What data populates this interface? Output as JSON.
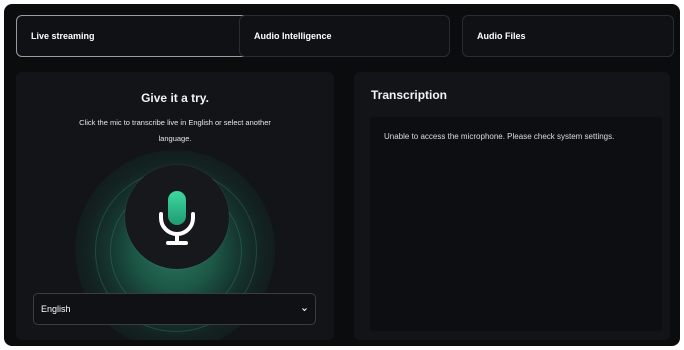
{
  "tabs": [
    {
      "label": "Live streaming",
      "active": true
    },
    {
      "label": "Audio Intelligence",
      "active": false
    },
    {
      "label": "Audio Files",
      "active": false
    }
  ],
  "demo": {
    "title": "Give it a try.",
    "subtitle": "Click the mic to transcribe live in English or select another language.",
    "mic_icon": "microphone-icon",
    "language": {
      "selected": "English",
      "icon": "chevron-down-icon"
    }
  },
  "transcription": {
    "title": "Transcription",
    "message": "Unable to access the microphone. Please check system settings."
  },
  "colors": {
    "background": "#0b0c0e",
    "panel": "#121418",
    "accent_green": "#3dd9a0",
    "text": "#ffffff"
  }
}
